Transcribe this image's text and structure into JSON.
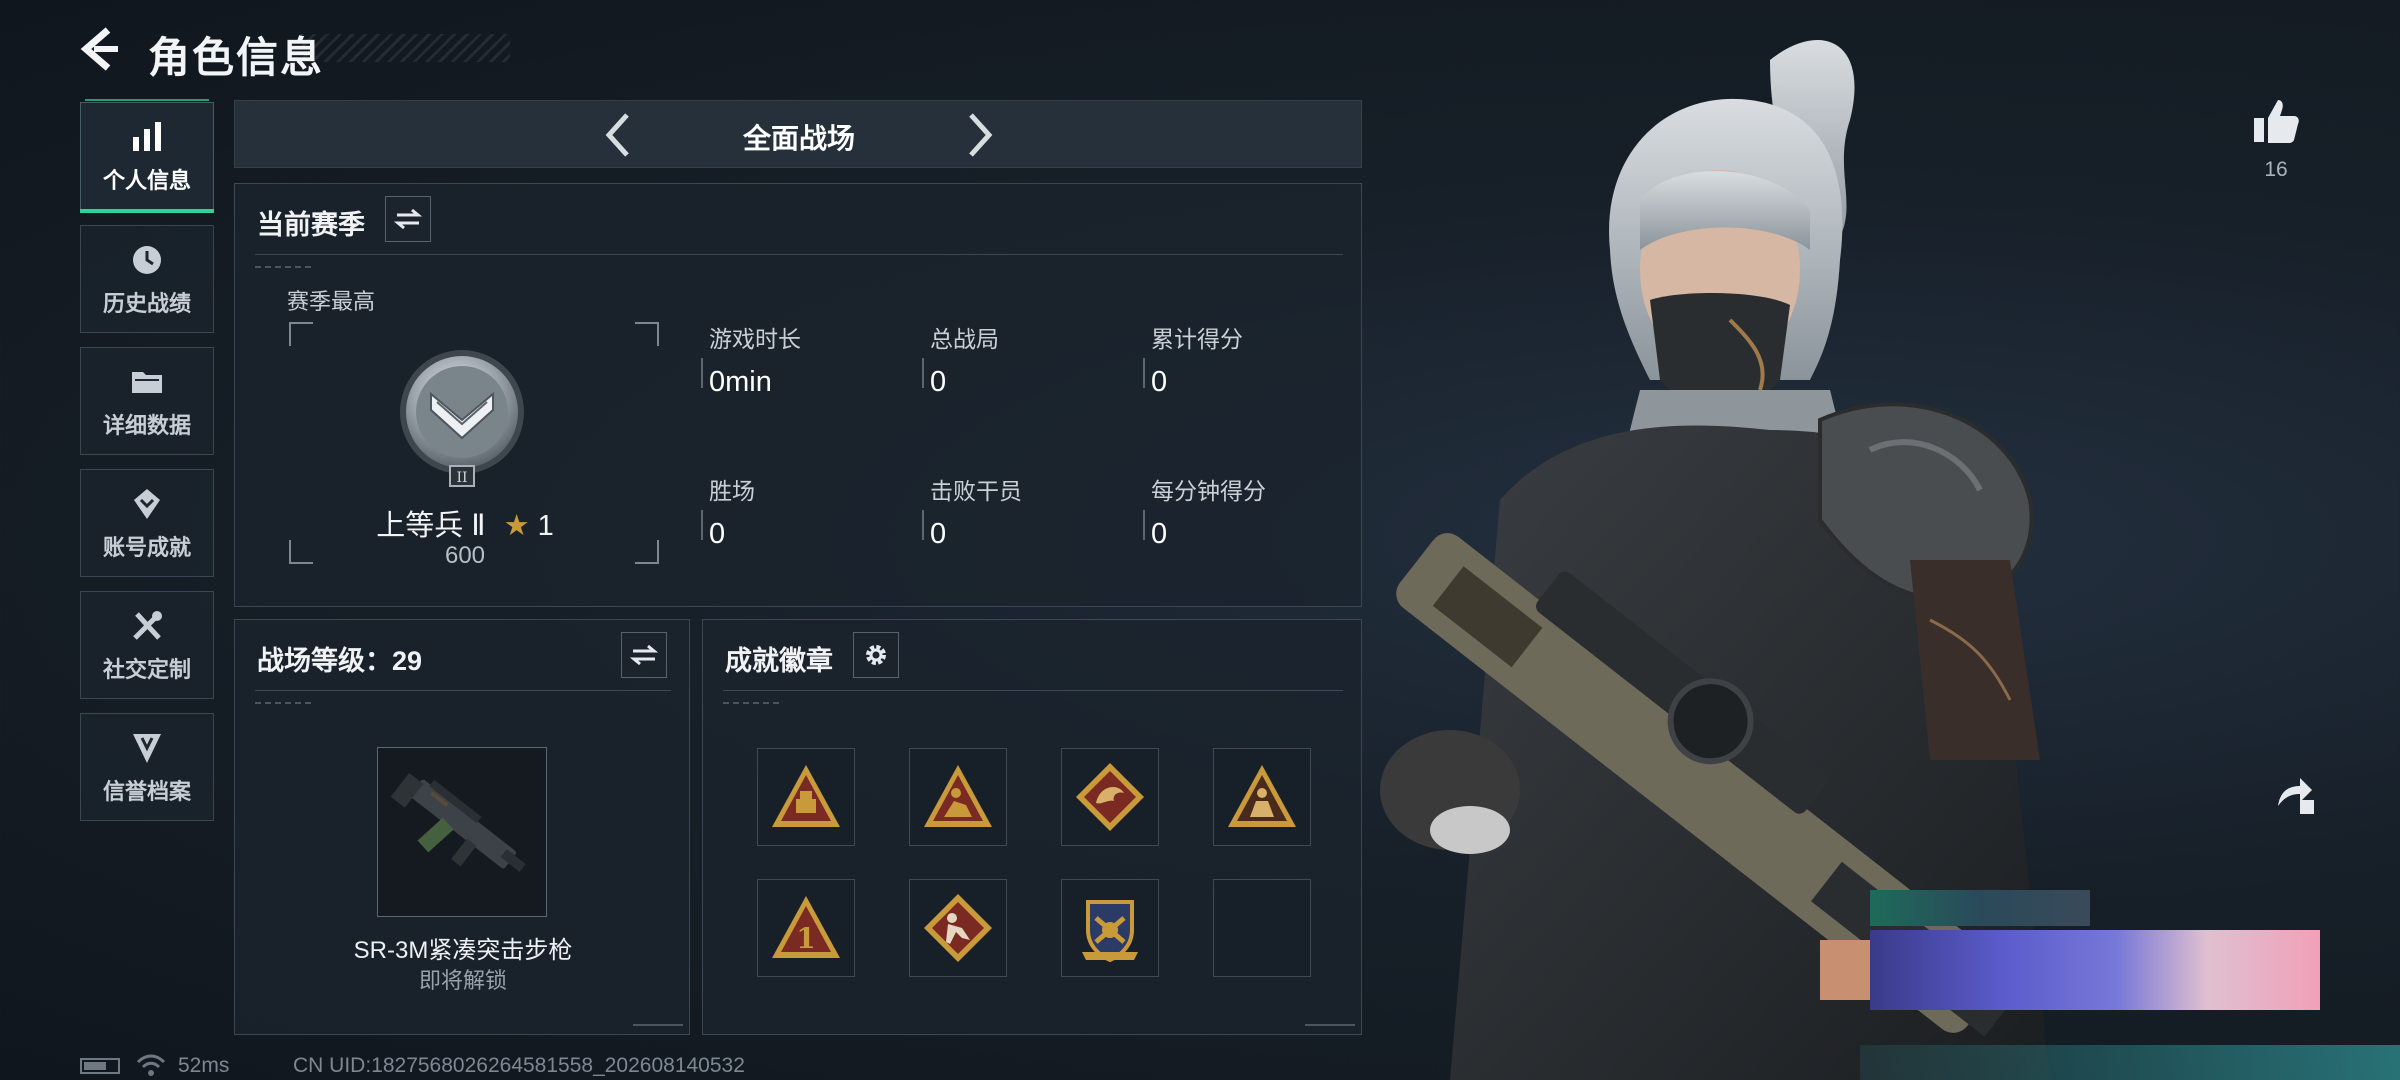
{
  "header": {
    "title": "角色信息",
    "back_icon": "back-arrow-icon"
  },
  "sidebar": {
    "items": [
      {
        "label": "个人信息",
        "icon": "bar-chart-icon",
        "active": true
      },
      {
        "label": "历史战绩",
        "icon": "history-icon",
        "active": false
      },
      {
        "label": "详细数据",
        "icon": "folder-icon",
        "active": false
      },
      {
        "label": "账号成就",
        "icon": "achievement-icon",
        "active": false
      },
      {
        "label": "社交定制",
        "icon": "tools-icon",
        "active": false
      },
      {
        "label": "信誉档案",
        "icon": "credit-shield-icon",
        "active": false
      }
    ]
  },
  "mode": {
    "title": "全面战场"
  },
  "season": {
    "title": "当前赛季",
    "best_label": "赛季最高",
    "rank_name": "上等兵 Ⅱ",
    "rank_stars": "1",
    "rank_points": "600",
    "stats": [
      {
        "label": "游戏时长",
        "value": "0min"
      },
      {
        "label": "总战局",
        "value": "0"
      },
      {
        "label": "累计得分",
        "value": "0"
      },
      {
        "label": "胜场",
        "value": "0"
      },
      {
        "label": "击败干员",
        "value": "0"
      },
      {
        "label": "每分钟得分",
        "value": "0"
      }
    ]
  },
  "level": {
    "title": "战场等级：29",
    "weapon_name": "SR-3M紧凑突击步枪",
    "weapon_status": "即将解锁"
  },
  "achievements": {
    "title": "成就徽章",
    "badges": [
      "triangle-badge-icon",
      "triangle-figure-badge-icon",
      "dragon-diamond-badge-icon",
      "triangle-soldier-badge-icon",
      "triangle-number-one-badge-icon",
      "diamond-runner-badge-icon",
      "shield-crest-badge-icon",
      "empty-slot"
    ]
  },
  "status": {
    "ping": "52ms",
    "uid": "CN UID:1827568026264581558_202608140532"
  },
  "like": {
    "count": "16"
  },
  "colors": {
    "accent": "#2fd39a",
    "gold": "#c99a3a",
    "badge_red": "#7a2a22"
  }
}
